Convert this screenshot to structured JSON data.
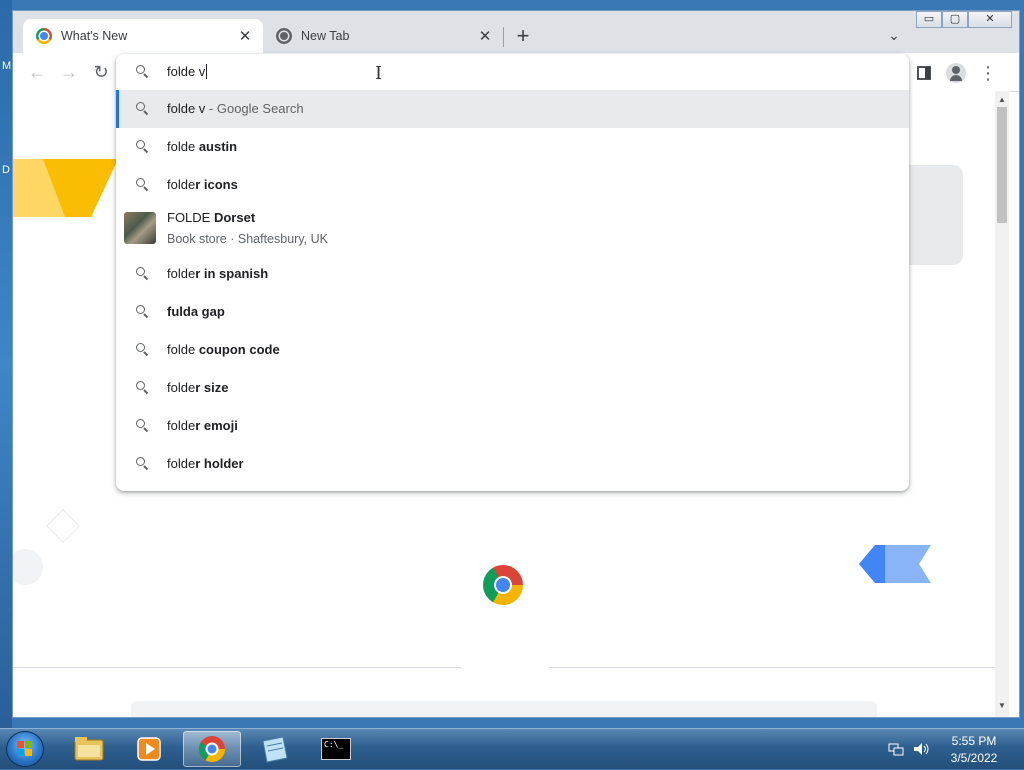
{
  "desktop": {
    "fragment_1": "M",
    "fragment_2": "D"
  },
  "browser": {
    "tabs": [
      {
        "title": "What's New",
        "active": true
      },
      {
        "title": "New Tab",
        "active": false
      }
    ],
    "window_controls": {
      "minimize": "▭",
      "maximize": "▢",
      "close": "✕"
    },
    "toolbar": {
      "back": "←",
      "forward": "→",
      "reload": "↻",
      "more": "⋮"
    },
    "omnibox": {
      "value": "folde v",
      "suggestions": [
        {
          "icon": "search-icon",
          "typed": "folde v",
          "bold": "",
          "suffix": " - Google Search",
          "selected": true
        },
        {
          "icon": "search-icon",
          "typed": "folde ",
          "bold": "austin"
        },
        {
          "icon": "search-icon",
          "typed": "folde",
          "bold": "r icons"
        },
        {
          "icon": "place-thumbnail",
          "typed": "FOLDE ",
          "bold": "Dorset",
          "subtitle": "Book store · Shaftesbury, UK"
        },
        {
          "icon": "search-icon",
          "typed": "folde",
          "bold": "r in spanish"
        },
        {
          "icon": "search-icon",
          "typed": "",
          "bold": "fulda gap"
        },
        {
          "icon": "search-icon",
          "typed": "folde ",
          "bold": "coupon code"
        },
        {
          "icon": "search-icon",
          "typed": "folde",
          "bold": "r size"
        },
        {
          "icon": "search-icon",
          "typed": "folde",
          "bold": "r emoji"
        },
        {
          "icon": "search-icon",
          "typed": "folde",
          "bold": "r holder"
        }
      ]
    },
    "colors": {
      "accent": "#1a73e8",
      "selected_row": "#e8eaed"
    }
  },
  "taskbar": {
    "apps": [
      "windows-explorer",
      "media-player",
      "chrome",
      "notepad",
      "command-prompt"
    ],
    "cmd_text": "C:\\_",
    "clock": {
      "time": "5:55 PM",
      "date": "3/5/2022"
    }
  }
}
